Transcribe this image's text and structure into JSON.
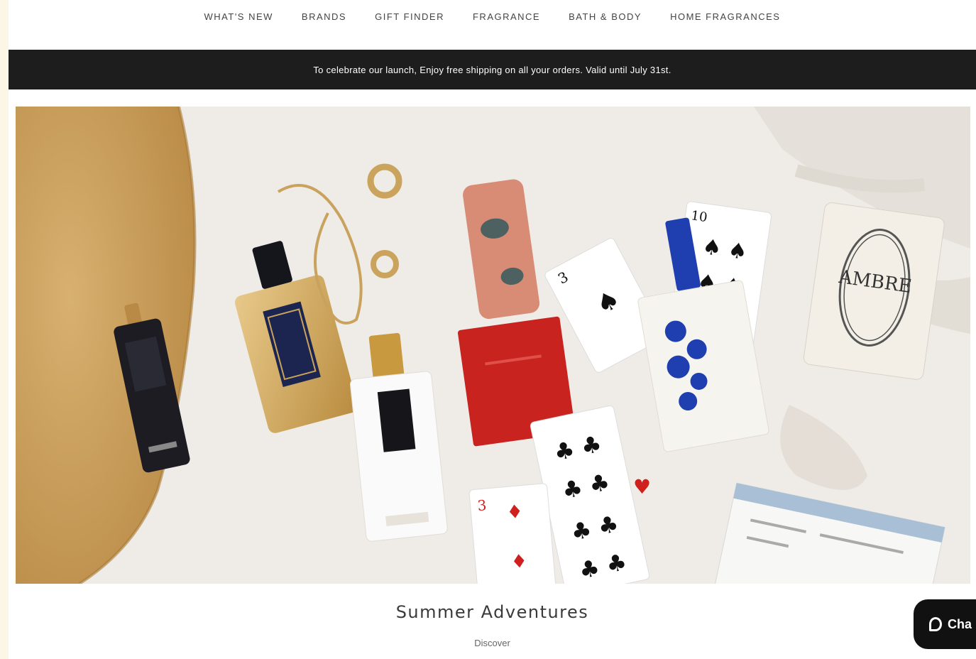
{
  "nav": {
    "items": [
      {
        "label": "WHAT'S NEW"
      },
      {
        "label": "BRANDS"
      },
      {
        "label": "GIFT FINDER"
      },
      {
        "label": "FRAGRANCE"
      },
      {
        "label": "BATH & BODY"
      },
      {
        "label": "HOME FRAGRANCES"
      }
    ]
  },
  "promo": {
    "text": "To celebrate our launch, Enjoy free shipping on all your orders. Valid until July 31st."
  },
  "hero": {
    "candle_label": "AMBRE"
  },
  "caption": {
    "title": "Summer Adventures",
    "link": "Discover"
  },
  "chat": {
    "label": "Cha"
  },
  "colors": {
    "page_bg": "#ffffff",
    "outer_bg": "#fbf6e6",
    "promo_bg": "#1d1d1d",
    "hero_bg": "#efece7",
    "sand": "#c9a15f",
    "red_box": "#c8231f",
    "blue": "#1f3fb0"
  }
}
